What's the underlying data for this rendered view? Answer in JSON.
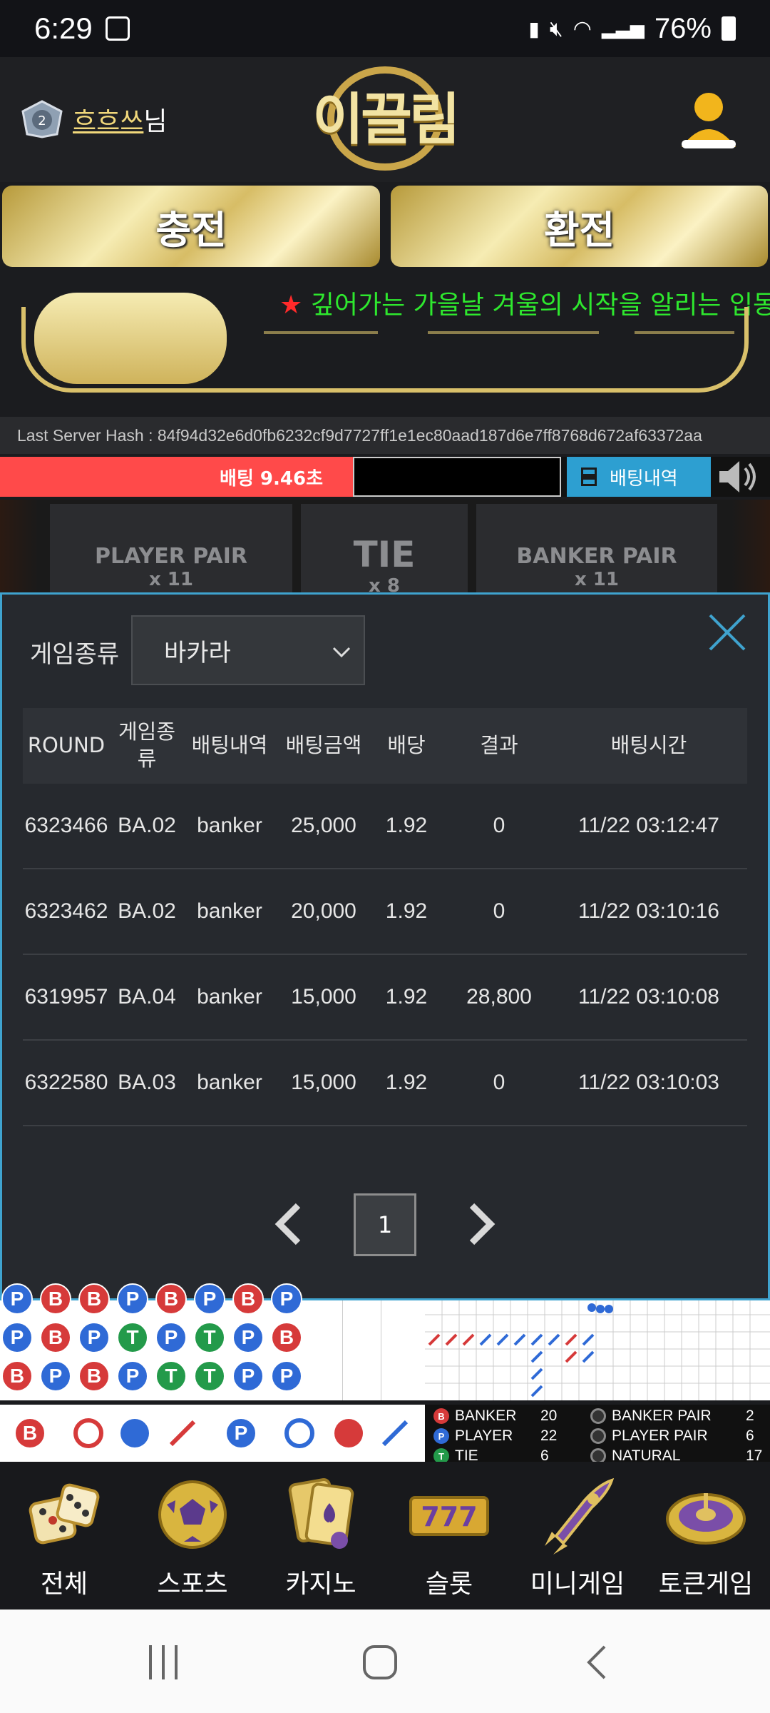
{
  "status_bar": {
    "time": "6:29",
    "battery": "76%"
  },
  "header": {
    "username": "흐흐쓰",
    "username_suffix": "님",
    "logo_text": "이끌림",
    "charge_label": "충전",
    "exchange_label": "환전"
  },
  "marquee": {
    "star": "★",
    "text": "깊어가는 가을날 겨울의 시작을 알리는 입동이"
  },
  "server_hash": "Last Server Hash : 84f94d32e6d0fb6232cf9d7727ff1e1ec80aad187d6e7ff8768d672af63372aa",
  "bet_bar": {
    "timer_label": "배팅 9.46초",
    "history_label": "배팅내역"
  },
  "zones": [
    {
      "name": "PLAYER PAIR",
      "mult": "x 11"
    },
    {
      "name": "TIE",
      "mult": "x 8"
    },
    {
      "name": "BANKER PAIR",
      "mult": "x 11"
    }
  ],
  "modal": {
    "game_type_label": "게임종류",
    "selected_game": "바카라",
    "columns": [
      "ROUND",
      "게임종류",
      "배팅내역",
      "배팅금액",
      "배당",
      "결과",
      "배팅시간"
    ],
    "rows": [
      {
        "round": "6323466",
        "game": "BA.02",
        "bet": "banker",
        "amount": "25,000",
        "odds": "1.92",
        "result": "0",
        "time": "11/22 03:12:47"
      },
      {
        "round": "6323462",
        "game": "BA.02",
        "bet": "banker",
        "amount": "20,000",
        "odds": "1.92",
        "result": "0",
        "time": "11/22 03:10:16"
      },
      {
        "round": "6319957",
        "game": "BA.04",
        "bet": "banker",
        "amount": "15,000",
        "odds": "1.92",
        "result": "28,800",
        "time": "11/22 03:10:08"
      },
      {
        "round": "6322580",
        "game": "BA.03",
        "bet": "banker",
        "amount": "15,000",
        "odds": "1.92",
        "result": "0",
        "time": "11/22 03:10:03"
      }
    ],
    "current_page": "1"
  },
  "bead_road": [
    [
      "P",
      "B",
      "B",
      "P",
      "B",
      "P",
      "B",
      "P"
    ],
    [
      "P",
      "B",
      "P",
      "T",
      "P",
      "T",
      "P",
      "B"
    ],
    [
      "B",
      "P",
      "B",
      "P",
      "T",
      "T",
      "P",
      "P"
    ]
  ],
  "legend_beads": [
    "B",
    "P"
  ],
  "stats": [
    {
      "key": "B",
      "label": "BANKER",
      "value": "20",
      "color": "#d63a3a"
    },
    {
      "key": "P",
      "label": "PLAYER",
      "value": "22",
      "color": "#2f6ad6"
    },
    {
      "key": "T",
      "label": "TIE",
      "value": "6",
      "color": "#239a4a"
    },
    {
      "key": "",
      "label": "BANKER PAIR",
      "value": "2",
      "color": "#333"
    },
    {
      "key": "",
      "label": "PLAYER PAIR",
      "value": "6",
      "color": "#333"
    },
    {
      "key": "",
      "label": "NATURAL",
      "value": "17",
      "color": "#333"
    }
  ],
  "bottom_nav": [
    {
      "label": "전체",
      "icon": "dice-icon"
    },
    {
      "label": "스포츠",
      "icon": "soccer-ball-icon"
    },
    {
      "label": "카지노",
      "icon": "cards-icon"
    },
    {
      "label": "슬롯",
      "icon": "slot-777-icon"
    },
    {
      "label": "미니게임",
      "icon": "rocket-icon"
    },
    {
      "label": "토큰게임",
      "icon": "roulette-icon"
    }
  ]
}
